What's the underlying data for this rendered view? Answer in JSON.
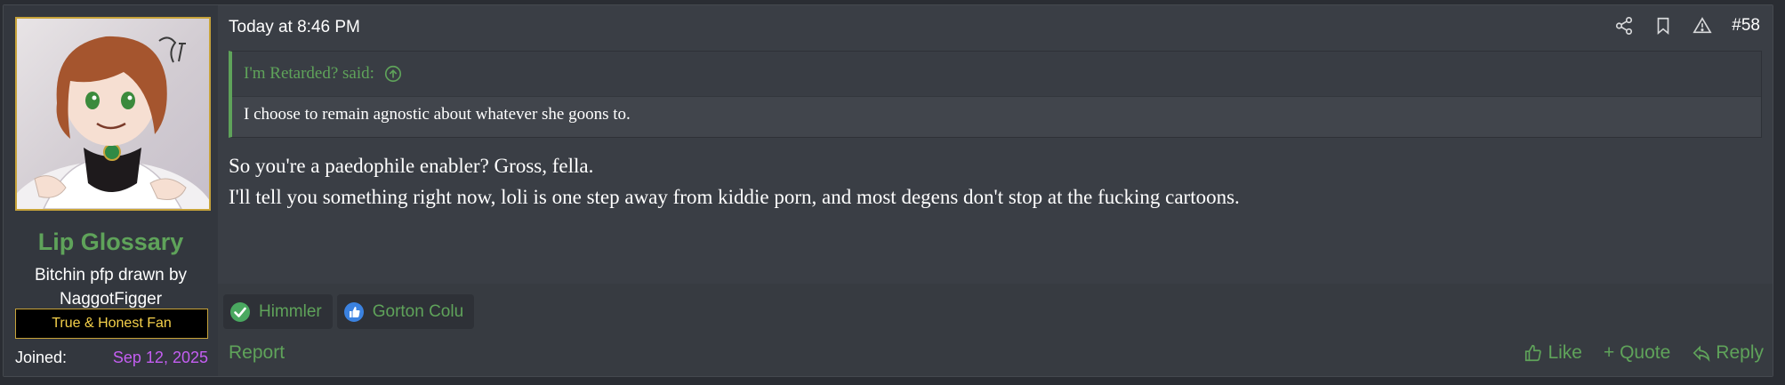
{
  "user": {
    "name": "Lip Glossary",
    "custom_title": "Bitchin pfp drawn by NaggotFigger",
    "banner": "True & Honest Fan",
    "joined_label": "Joined:",
    "joined_date": "Sep 12, 2025"
  },
  "post": {
    "date": "Today at 8:46 PM",
    "number": "#58",
    "quote": {
      "author_said": "I'm Retarded? said:",
      "text": "I choose to remain agnostic about whatever she goons to."
    },
    "message_lines": [
      "So you're a paedophile enabler? Gross, fella.",
      "I'll tell you something right now, loli is one step away from kiddie porn, and most degens don't stop at the fucking cartoons."
    ]
  },
  "reactions": [
    {
      "name": "Himmler",
      "icon": "check-icon",
      "color": "#4aa860"
    },
    {
      "name": "Gorton Colu",
      "icon": "thumbs-up-icon",
      "color": "#3b82e0"
    }
  ],
  "footer": {
    "report": "Report",
    "like": "Like",
    "quote": "+ Quote",
    "reply": "Reply"
  },
  "icons": {
    "tools": [
      "share-icon",
      "bookmark-icon",
      "warning-icon"
    ],
    "quote_jump": "arrow-up-circle-icon"
  },
  "colors": {
    "accent_green": "#5fa35a",
    "banner_text": "#f4d04a",
    "banner_border": "#c7a33a",
    "joined_date": "#c45ef2",
    "post_bg": "#3a3e45"
  }
}
